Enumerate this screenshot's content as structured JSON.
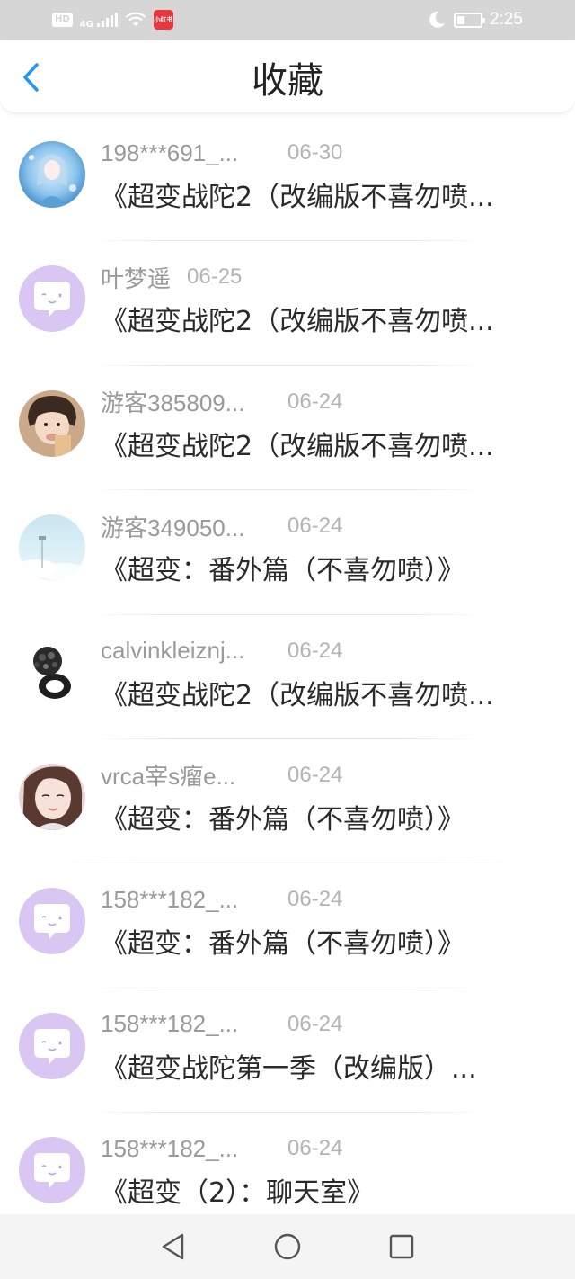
{
  "status_bar": {
    "hd": "HD",
    "network": "4G",
    "notif_label": "小红书",
    "time": "2:25"
  },
  "header": {
    "title": "收藏"
  },
  "colors": {
    "accent": "#2196f3",
    "avatar_default_bg": "#d9c6f2",
    "avatar_default_fg": "#a07fd6"
  },
  "items": [
    {
      "user": "198***691_...",
      "date": "06-30",
      "title": "《超变战陀2（改编版不喜勿喷...",
      "avatar": "anime-girl"
    },
    {
      "user": "叶梦遥",
      "date": "06-25",
      "title": "《超变战陀2（改编版不喜勿喷...",
      "avatar": "default"
    },
    {
      "user": "游客385809...",
      "date": "06-24",
      "title": "《超变战陀2（改编版不喜勿喷...",
      "avatar": "child-photo"
    },
    {
      "user": "游客349050...",
      "date": "06-24",
      "title": "《超变：番外篇（不喜勿喷）》",
      "avatar": "sky-photo"
    },
    {
      "user": "calvinkleiznj...",
      "date": "06-24",
      "title": "《超变战陀2（改编版不喜勿喷...",
      "avatar": "ring-photo"
    },
    {
      "user": "vrca宰s瘤e...",
      "date": "06-24",
      "title": "《超变：番外篇（不喜勿喷）》",
      "avatar": "girl-photo"
    },
    {
      "user": "158***182_...",
      "date": "06-24",
      "title": "《超变：番外篇（不喜勿喷）》",
      "avatar": "default"
    },
    {
      "user": "158***182_...",
      "date": "06-24",
      "title": "《超变战陀第一季（改编版）...",
      "avatar": "default"
    },
    {
      "user": "158***182_...",
      "date": "06-24",
      "title": "《超变（2）：聊天室》",
      "avatar": "default"
    }
  ],
  "nav_bar": {
    "back": "back-triangle-icon",
    "home": "home-circle-icon",
    "recents": "recents-square-icon"
  }
}
